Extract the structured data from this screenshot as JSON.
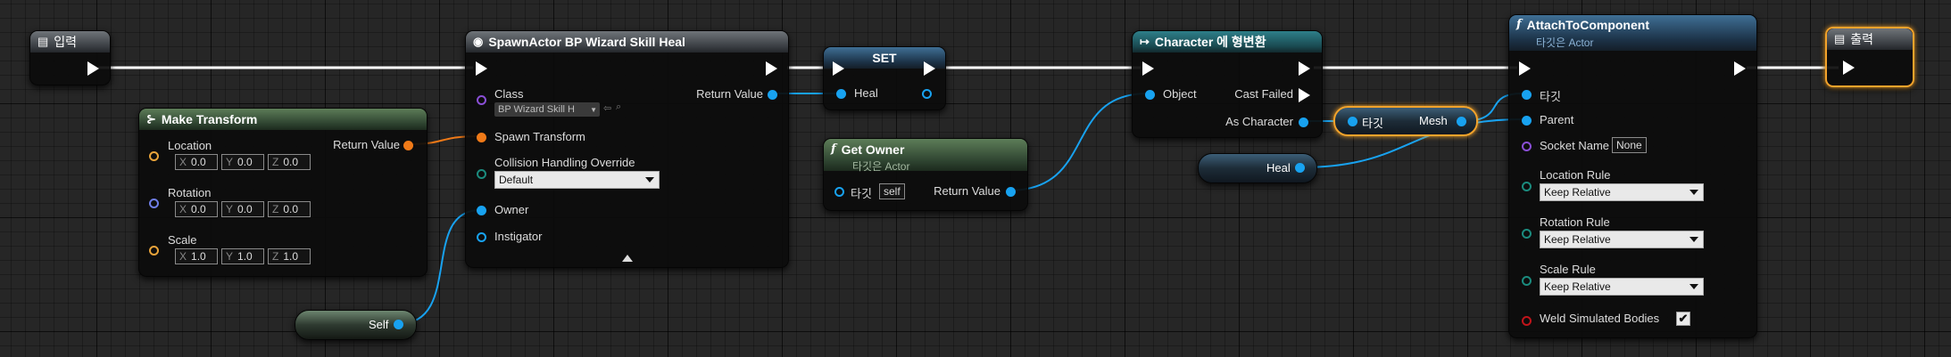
{
  "theme": {
    "exec_color": "#ffffff",
    "object_pin_color": "#18a2f0",
    "struct_pin_color": "#f07a18",
    "selection_color": "#f3a32b"
  },
  "input_node": {
    "title": "입력",
    "icon": "function-entry-icon"
  },
  "output_node": {
    "title": "출력",
    "icon": "function-result-icon"
  },
  "spawn_actor": {
    "title": "SpawnActor BP Wizard Skill Heal",
    "icon": "spawn-actor-icon",
    "pins": {
      "class": "Class",
      "class_value": "BP Wizard Skill H",
      "spawn_transform": "Spawn Transform",
      "collision": "Collision Handling Override",
      "collision_value": "Default",
      "owner": "Owner",
      "instigator": "Instigator",
      "return_value": "Return Value"
    }
  },
  "make_transform": {
    "title": "Make Transform",
    "icon": "make-struct-icon",
    "location": {
      "label": "Location",
      "x": "0.0",
      "y": "0.0",
      "z": "0.0"
    },
    "rotation": {
      "label": "Rotation",
      "x": "0.0",
      "y": "0.0",
      "z": "0.0"
    },
    "scale": {
      "label": "Scale",
      "x": "1.0",
      "y": "1.0",
      "z": "1.0"
    },
    "return_value": "Return Value",
    "axis_labels": {
      "x": "X",
      "y": "Y",
      "z": "Z"
    }
  },
  "self_node": {
    "label": "Self"
  },
  "set_node": {
    "title": "SET",
    "pin": "Heal"
  },
  "get_owner": {
    "title": "Get Owner",
    "subtitle": "타깃은 Actor",
    "target_label": "타깃",
    "target_value": "self",
    "return_value": "Return Value"
  },
  "cast_node": {
    "title": "Character 에 형변환",
    "object": "Object",
    "cast_failed": "Cast Failed",
    "as_character": "As Character"
  },
  "mesh_node": {
    "target": "타깃",
    "mesh": "Mesh"
  },
  "heal_node": {
    "label": "Heal"
  },
  "attach_node": {
    "title": "AttachToComponent",
    "subtitle": "타깃은 Actor",
    "target": "타깃",
    "parent": "Parent",
    "socket_name": "Socket Name",
    "socket_value": "None",
    "location_rule": "Location Rule",
    "location_rule_value": "Keep Relative",
    "rotation_rule": "Rotation Rule",
    "rotation_rule_value": "Keep Relative",
    "scale_rule": "Scale Rule",
    "scale_rule_value": "Keep Relative",
    "weld": "Weld Simulated Bodies",
    "weld_checked": "✔"
  }
}
